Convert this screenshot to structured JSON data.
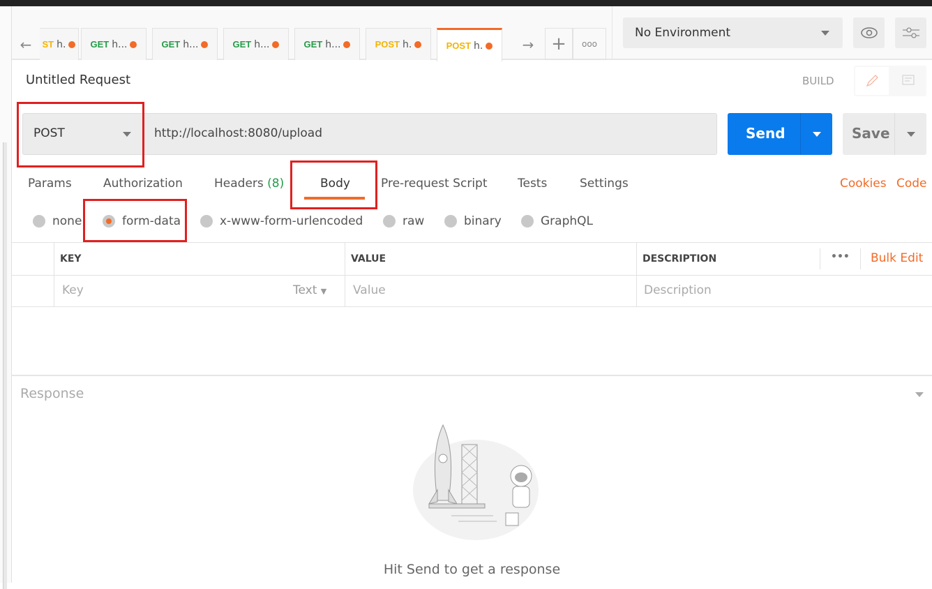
{
  "tabs": [
    {
      "method": "ST",
      "url": "h.",
      "method_color": "post"
    },
    {
      "method": "GET",
      "url": "h..."
    },
    {
      "method": "GET",
      "url": "h..."
    },
    {
      "method": "GET",
      "url": "h..."
    },
    {
      "method": "GET",
      "url": "h..."
    },
    {
      "method": "POST",
      "url": "h."
    },
    {
      "method": "POST",
      "url": "h.",
      "active": true
    }
  ],
  "environment": {
    "selected": "No Environment"
  },
  "request": {
    "title": "Untitled Request",
    "mode": "BUILD",
    "method": "POST",
    "url": "http://localhost:8080/upload",
    "send_label": "Send",
    "save_label": "Save"
  },
  "request_tabs": {
    "params": "Params",
    "authorization": "Authorization",
    "headers": "Headers",
    "headers_count": "(8)",
    "body": "Body",
    "prerequest": "Pre-request Script",
    "tests": "Tests",
    "settings": "Settings",
    "cookies": "Cookies",
    "code": "Code"
  },
  "body_types": {
    "none": "none",
    "form_data": "form-data",
    "urlencoded": "x-www-form-urlencoded",
    "raw": "raw",
    "binary": "binary",
    "graphql": "GraphQL",
    "selected": "form-data"
  },
  "table": {
    "headers": {
      "key": "KEY",
      "value": "VALUE",
      "description": "DESCRIPTION"
    },
    "more": "•••",
    "bulk_edit": "Bulk Edit",
    "placeholders": {
      "key": "Key",
      "type": "Text",
      "value": "Value",
      "description": "Description"
    }
  },
  "response": {
    "title": "Response",
    "empty_message": "Hit Send to get a response"
  },
  "colors": {
    "accent": "#f26b27",
    "send": "#097bed",
    "get": "#249c47",
    "post": "#f4b400",
    "annotation": "#e02020"
  }
}
